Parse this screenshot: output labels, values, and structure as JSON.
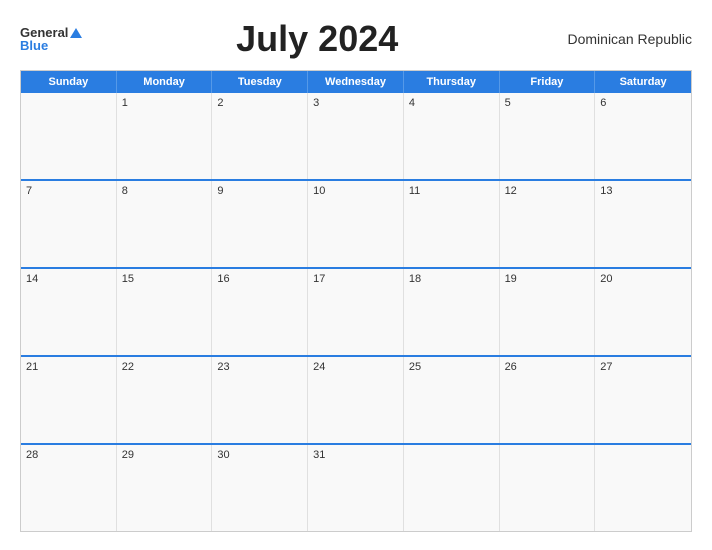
{
  "header": {
    "logo_general": "General",
    "logo_blue": "Blue",
    "title": "July 2024",
    "country": "Dominican Republic"
  },
  "calendar": {
    "days_of_week": [
      "Sunday",
      "Monday",
      "Tuesday",
      "Wednesday",
      "Thursday",
      "Friday",
      "Saturday"
    ],
    "weeks": [
      [
        {
          "day": "",
          "empty": true
        },
        {
          "day": "1",
          "empty": false
        },
        {
          "day": "2",
          "empty": false
        },
        {
          "day": "3",
          "empty": false
        },
        {
          "day": "4",
          "empty": false
        },
        {
          "day": "5",
          "empty": false
        },
        {
          "day": "6",
          "empty": false
        }
      ],
      [
        {
          "day": "7",
          "empty": false
        },
        {
          "day": "8",
          "empty": false
        },
        {
          "day": "9",
          "empty": false
        },
        {
          "day": "10",
          "empty": false
        },
        {
          "day": "11",
          "empty": false
        },
        {
          "day": "12",
          "empty": false
        },
        {
          "day": "13",
          "empty": false
        }
      ],
      [
        {
          "day": "14",
          "empty": false
        },
        {
          "day": "15",
          "empty": false
        },
        {
          "day": "16",
          "empty": false
        },
        {
          "day": "17",
          "empty": false
        },
        {
          "day": "18",
          "empty": false
        },
        {
          "day": "19",
          "empty": false
        },
        {
          "day": "20",
          "empty": false
        }
      ],
      [
        {
          "day": "21",
          "empty": false
        },
        {
          "day": "22",
          "empty": false
        },
        {
          "day": "23",
          "empty": false
        },
        {
          "day": "24",
          "empty": false
        },
        {
          "day": "25",
          "empty": false
        },
        {
          "day": "26",
          "empty": false
        },
        {
          "day": "27",
          "empty": false
        }
      ],
      [
        {
          "day": "28",
          "empty": false
        },
        {
          "day": "29",
          "empty": false
        },
        {
          "day": "30",
          "empty": false
        },
        {
          "day": "31",
          "empty": false
        },
        {
          "day": "",
          "empty": true
        },
        {
          "day": "",
          "empty": true
        },
        {
          "day": "",
          "empty": true
        }
      ]
    ]
  }
}
